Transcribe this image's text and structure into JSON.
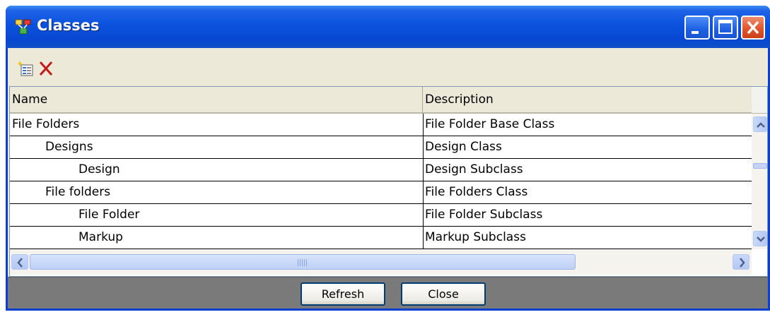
{
  "window": {
    "title": "Classes",
    "app_icon": "class-hierarchy-icon",
    "title_buttons": [
      "minimize-icon",
      "maximize-icon",
      "close-icon"
    ]
  },
  "toolbar": {
    "new_icon": "new-class-icon",
    "delete_icon": "delete-icon"
  },
  "grid": {
    "columns": [
      "Name",
      "Description"
    ],
    "rows": [
      {
        "name": "File Folders",
        "description": "File Folder Base Class",
        "level": 0
      },
      {
        "name": "Designs",
        "description": "Design Class",
        "level": 1
      },
      {
        "name": "Design",
        "description": "Design Subclass",
        "level": 2
      },
      {
        "name": "File folders",
        "description": "File Folders Class",
        "level": 1
      },
      {
        "name": "File Folder",
        "description": "File Folder Subclass",
        "level": 2
      },
      {
        "name": "Markup",
        "description": "Markup Subclass",
        "level": 2
      }
    ]
  },
  "buttons": {
    "refresh": "Refresh",
    "close": "Close"
  },
  "colors": {
    "titlebar": "#0a52de",
    "window_face": "#ece9d8",
    "footer": "#7a7a7a",
    "close_button": "#e2542c"
  }
}
